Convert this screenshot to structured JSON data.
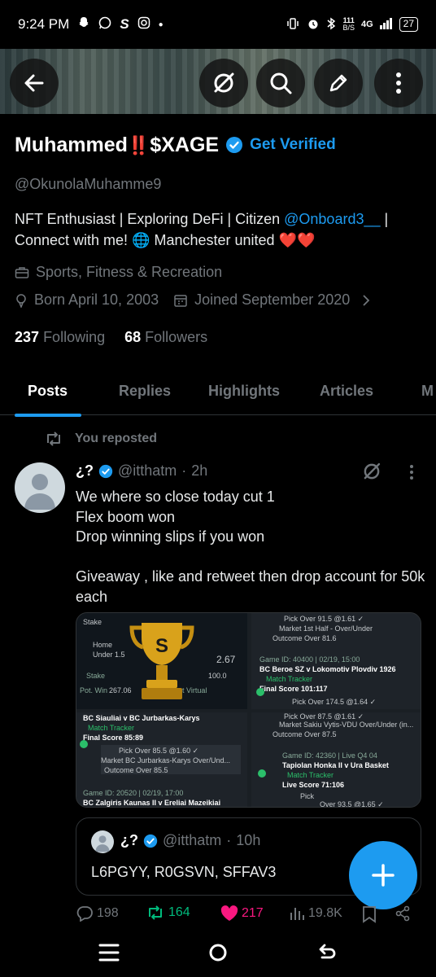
{
  "status": {
    "time": "9:24 PM",
    "net_speed_value": "111",
    "net_speed_unit": "B/S",
    "network": "4G",
    "battery": "27"
  },
  "header": {
    "buttons": [
      "back",
      "grok",
      "search",
      "edit",
      "more"
    ]
  },
  "profile": {
    "name": "Muhammed",
    "name_suffix": "‼️",
    "name_tag": "$XAGE",
    "get_verified": "Get Verified",
    "handle": "@OkunolaMuhamme9",
    "bio_part1": "NFT Enthusiast | Exploring DeFi | Citizen ",
    "bio_link": "@Onboard3__",
    "bio_part2": " | Connect with me! 🌐  Manchester united ❤️❤️",
    "category": "Sports, Fitness & Recreation",
    "born": "Born April 10, 2003",
    "joined": "Joined September 2020",
    "following_count": "237",
    "following_label": "Following",
    "followers_count": "68",
    "followers_label": "Followers"
  },
  "tabs": [
    "Posts",
    "Replies",
    "Highlights",
    "Articles",
    "M"
  ],
  "tweet": {
    "repost_label": "You reposted",
    "author": "¿?",
    "handle": "@itthatm",
    "time": "2h",
    "text": "We where so close today cut 1\nFlex boom won\nDrop winning slips if you won\n\nGiveaway , like and retweet then drop account for 50k each",
    "media": {
      "tl": {
        "stake_label": "Stake",
        "stake_value": "100.0",
        "pot_win_label": "Pot. Win",
        "pot_win_value": "267.06",
        "get_virtual": "Get Virtual",
        "odds": "2.67",
        "home": "Home",
        "under": "Under 1.5"
      },
      "tr": {
        "pick": "Pick  Over 91.5 @1.61 ✓",
        "market": "Market  1st Half - Over/Under",
        "outcome": "Outcome  Over 81.6",
        "game_id": "Game ID: 40400 | 02/19, 15:00",
        "match": "BC Beroe SZ v Lokomotiv Plovdiv 1926",
        "tracker": "Match Tracker",
        "final": "Final Score  101:117",
        "pick2": "Pick  Over 174.5 @1.64 ✓"
      },
      "bl": {
        "match": "BC Siauliai v BC Jurbarkas-Karys",
        "tracker": "Match Tracker",
        "final": "Final Score  85:89",
        "pick": "Pick  Over 85.5 @1.60 ✓",
        "market": "Market  BC Jurbarkas-Karys Over/Und...",
        "outcome": "Outcome  Over 85.5",
        "game_id": "Game ID: 20520 | 02/19, 17:00",
        "match2": "BC Zalgiris Kaunas II v Ereliai Mazeikiai"
      },
      "br": {
        "pick": "Pick  Over 87.5 @1.61 ✓",
        "market": "Market  Sakiu Vytis-VDU Over/Under (in...",
        "outcome": "Outcome  Over 87.5",
        "game_id": "Game ID: 42360 | Live  Q4 04",
        "match": "Tapiolan Honka II v Ura Basket",
        "tracker": "Match Tracker",
        "live": "Live Score  71:106",
        "pick2": "Pick",
        "over": "Over 93.5 @1.65 ✓"
      }
    },
    "quote": {
      "author": "¿?",
      "handle": "@itthatm",
      "time": "10h",
      "text": "L6PGYY, R0GSVN, SFFAV3"
    },
    "counts": {
      "replies": "198",
      "reposts": "164",
      "likes": "217",
      "views": "19.8K"
    }
  },
  "colors": {
    "accent": "#1d9bf0",
    "repost": "#00ba7c",
    "like": "#f91880",
    "muted": "#71767b"
  }
}
